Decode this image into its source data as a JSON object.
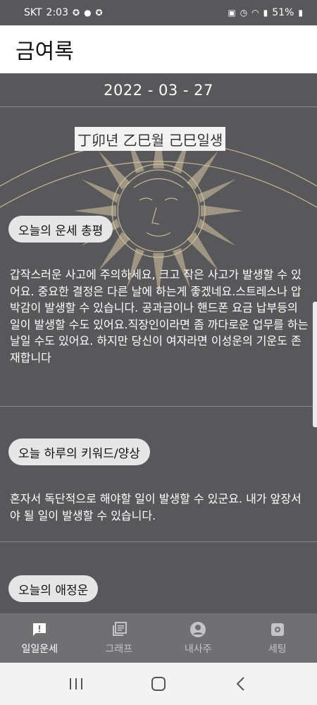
{
  "status_bar": {
    "carrier": "SKT",
    "time": "2:03",
    "battery": "51%"
  },
  "app": {
    "title": "금여록"
  },
  "main": {
    "date": "2022 - 03 - 27",
    "ganji": "丁卯년 乙巳월 己巳일생",
    "sections": [
      {
        "title": "오늘의 운세 총평",
        "body": "갑작스러운 사고에 주의하세요, 크고 작은 사고가 발생할 수 있어요. 중요한 결정은 다른 날에 하는게 좋겠네요.스트레스나 압박감이 발생할 수 있습니다. 공과금이나 핸드폰 요금 납부등의 일이 발생할 수도 있어요.직장인이라면 좀 까다로운 업무를 하는 날일 수도 있어요. 하지만 당신이 여자라면 이성운의 기운도 존재합니다"
      },
      {
        "title": "오늘 하루의 키워드/양상",
        "body": "혼자서 독단적으로 해야할 일이 발생할 수 있군요. 내가 앞장서야 될 일이 발생할 수 있습니다."
      },
      {
        "title": "오늘의 애정운",
        "body": ""
      }
    ]
  },
  "bottom_nav": {
    "items": [
      {
        "label": "일일운세",
        "icon": "alert-message-icon",
        "active": true
      },
      {
        "label": "그래프",
        "icon": "library-books-icon",
        "active": false
      },
      {
        "label": "내사주",
        "icon": "account-circle-icon",
        "active": false
      },
      {
        "label": "세팅",
        "icon": "settings-gear-icon",
        "active": false
      }
    ]
  },
  "colors": {
    "background": "#58585a",
    "app_bar": "#ffffff",
    "nav_bar": "#707072",
    "pill": "#e6e6e6",
    "art": "#d8c9a6"
  }
}
